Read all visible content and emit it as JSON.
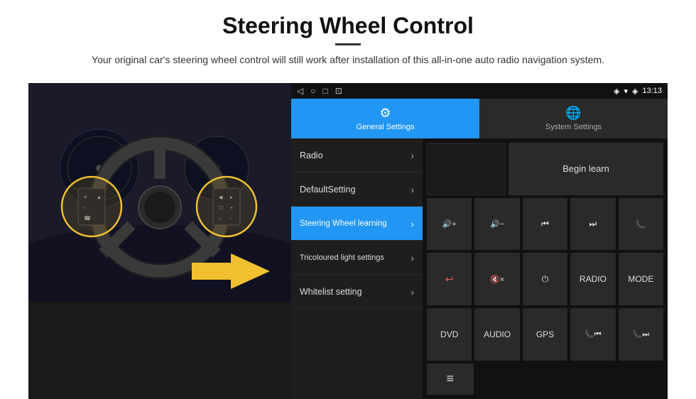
{
  "header": {
    "title": "Steering Wheel Control",
    "divider": true,
    "subtitle": "Your original car's steering wheel control will still work after installation of this all-in-one auto radio navigation system."
  },
  "status_bar": {
    "time": "13:13",
    "icons": [
      "location",
      "signal",
      "wifi"
    ]
  },
  "tabs": [
    {
      "id": "general",
      "label": "General Settings",
      "icon": "⚙",
      "active": true
    },
    {
      "id": "system",
      "label": "System Settings",
      "icon": "🌐",
      "active": false
    }
  ],
  "menu": {
    "items": [
      {
        "label": "Radio",
        "active": false
      },
      {
        "label": "DefaultSetting",
        "active": false
      },
      {
        "label": "Steering Wheel learning",
        "active": true
      },
      {
        "label": "Tricoloured light settings",
        "active": false
      },
      {
        "label": "Whitelist setting",
        "active": false
      }
    ]
  },
  "grid": {
    "begin_learn": "Begin learn",
    "rows": [
      [
        {
          "label": "🔊+",
          "name": "vol-up"
        },
        {
          "label": "🔊−",
          "name": "vol-down"
        },
        {
          "label": "⏮",
          "name": "prev-track"
        },
        {
          "label": "⏭",
          "name": "next-track"
        },
        {
          "label": "📞",
          "name": "phone"
        }
      ],
      [
        {
          "label": "↩",
          "name": "back-call"
        },
        {
          "label": "🔇x",
          "name": "mute"
        },
        {
          "label": "⏻",
          "name": "power"
        },
        {
          "label": "RADIO",
          "name": "radio-btn"
        },
        {
          "label": "MODE",
          "name": "mode-btn"
        }
      ],
      [
        {
          "label": "DVD",
          "name": "dvd-btn"
        },
        {
          "label": "AUDIO",
          "name": "audio-btn"
        },
        {
          "label": "GPS",
          "name": "gps-btn"
        },
        {
          "label": "📞⏮",
          "name": "phone-prev"
        },
        {
          "label": "📞⏭",
          "name": "phone-next"
        }
      ],
      [
        {
          "label": "≡",
          "name": "menu-icon-btn"
        }
      ]
    ]
  }
}
